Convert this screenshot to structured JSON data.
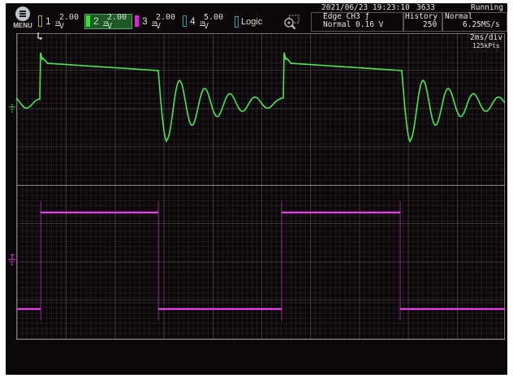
{
  "menu": {
    "label": "MENU"
  },
  "channels": [
    {
      "num": "1",
      "volts": "2.00 V",
      "impedance": "1M",
      "color": "#b8a42c",
      "active": false
    },
    {
      "num": "2",
      "volts": "2.00 V",
      "impedance": "1M",
      "color": "#35e335",
      "active": true
    },
    {
      "num": "3",
      "volts": "2.00 V",
      "impedance": "1M",
      "color": "#e01ee0",
      "active": false
    },
    {
      "num": "4",
      "volts": "5.00 V",
      "impedance": "1M",
      "color": "#1fa7a7",
      "active": false
    }
  ],
  "logic": {
    "label": "Logic"
  },
  "status": {
    "datetime": "2021/06/23 19:23:10",
    "count": "3633",
    "run_state": "Running",
    "trigger_type": "Edge CH3 ƒ",
    "trigger_mode_level": "Normal 0.16 V",
    "history_label": "History",
    "history_value": "250",
    "acq_mode": "Normal",
    "sample_rate": "6.25MS/s",
    "timebase": "2ms/div",
    "record_length": "125kPts"
  },
  "colors": {
    "ch2": "#4be84b",
    "ch3": "#e43ee4"
  }
}
